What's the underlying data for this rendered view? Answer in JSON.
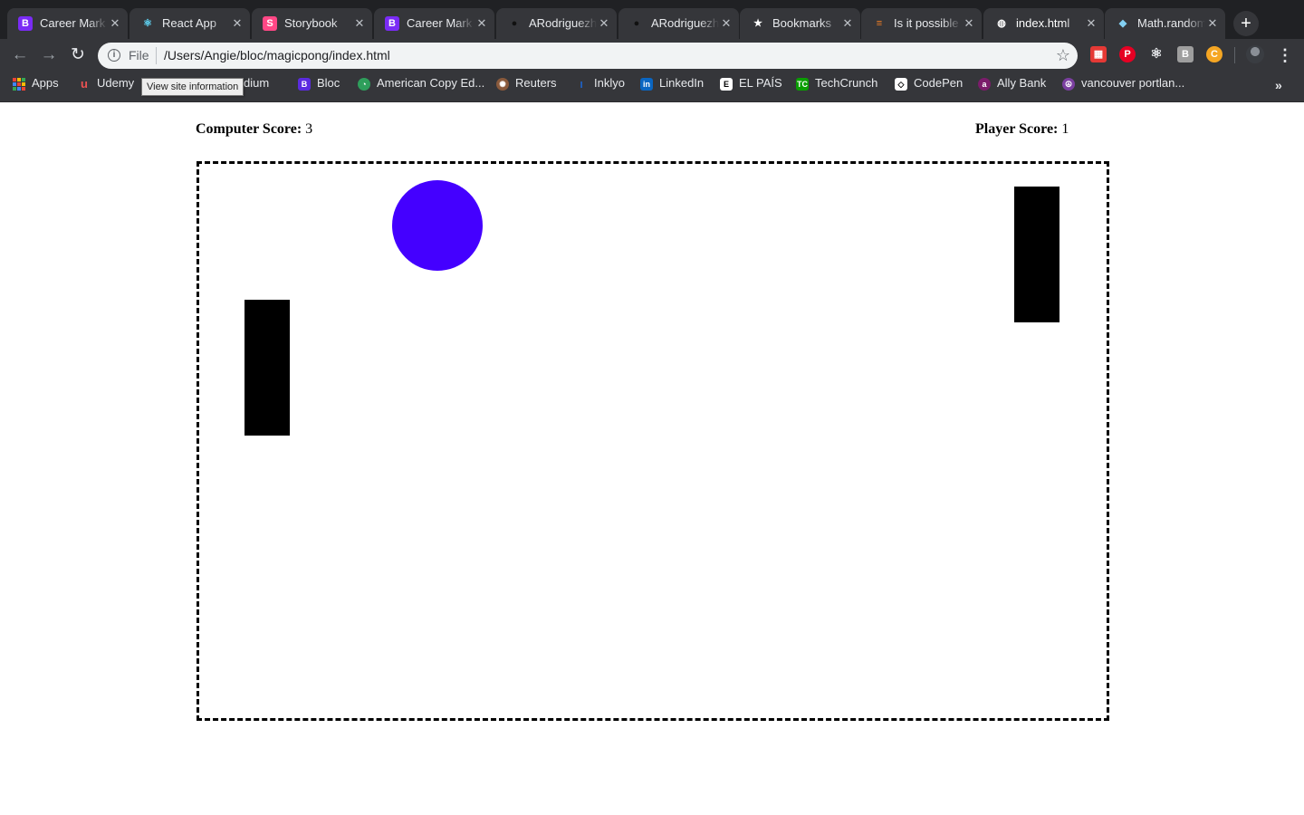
{
  "browser": {
    "tabs": [
      {
        "title": "Career Mark",
        "favicon": "bootstrap-icon",
        "favicon_char": "B",
        "favicon_color": "#7a2bf5"
      },
      {
        "title": "React App",
        "favicon": "react-icon",
        "favicon_char": "⚛",
        "favicon_color": "#61dafb"
      },
      {
        "title": "Storybook",
        "favicon": "storybook-icon",
        "favicon_char": "S",
        "favicon_color": "#ff4785"
      },
      {
        "title": "Career Mark",
        "favicon": "bootstrap-icon",
        "favicon_char": "B",
        "favicon_color": "#7a2bf5"
      },
      {
        "title": "ARodriguezh",
        "favicon": "github-icon",
        "favicon_char": "●",
        "favicon_color": "#111111"
      },
      {
        "title": "ARodriguezh",
        "favicon": "github-icon",
        "favicon_char": "●",
        "favicon_color": "#111111"
      },
      {
        "title": "Bookmarks",
        "favicon": "star-icon",
        "favicon_char": "★",
        "favicon_color": "#ffffff"
      },
      {
        "title": "Is it possible",
        "favicon": "stackoverflow-icon",
        "favicon_char": "≡",
        "favicon_color": "#f48024"
      },
      {
        "title": "index.html",
        "favicon": "globe-icon",
        "favicon_char": "◍",
        "favicon_color": "#ffffff",
        "active": true
      },
      {
        "title": "Math.random",
        "favicon": "mdn-icon",
        "favicon_char": "◆",
        "favicon_color": "#83d0f2"
      }
    ],
    "close_glyph": "✕",
    "new_tab_glyph": "+",
    "omnibox": {
      "scheme_chip": "File",
      "url": "/Users/Angie/bloc/magicpong/index.html"
    },
    "extensions": [
      {
        "name": "clapperboard-extension-icon",
        "char": "▦",
        "color": "#e53935"
      },
      {
        "name": "pinterest-extension-icon",
        "char": "P",
        "color": "#e60023"
      },
      {
        "name": "react-devtools-extension-icon",
        "char": "⚛",
        "color": "#35363a"
      },
      {
        "name": "bloc-extension-icon",
        "char": "B",
        "color": "#9e9e9e"
      },
      {
        "name": "cplus-extension-icon",
        "char": "C",
        "color": "#f5a623"
      }
    ],
    "bookmarks": [
      {
        "label": "Apps",
        "icon": "apps-grid-icon",
        "char": "",
        "color": "#ea4335"
      },
      {
        "label": "Udemy",
        "icon": "udemy-icon",
        "char": "u",
        "color": "#ec5252"
      },
      {
        "label": "Medium",
        "icon": "medium-icon",
        "char": "M",
        "color": "#000000"
      },
      {
        "label": "Bloc",
        "icon": "bloc-icon",
        "char": "B",
        "color": "#5b2be0"
      },
      {
        "label": "American Copy Ed...",
        "icon": "aces-icon",
        "char": "◔",
        "color": "#2e9e5b"
      },
      {
        "label": "Reuters",
        "icon": "reuters-icon",
        "char": "✺",
        "color": "#8a5a3c"
      },
      {
        "label": "Inklyo",
        "icon": "inklyo-icon",
        "char": "ı",
        "color": "#1f5fbf"
      },
      {
        "label": "LinkedIn",
        "icon": "linkedin-icon",
        "char": "in",
        "color": "#0a66c2"
      },
      {
        "label": "EL PAÍS",
        "icon": "elpais-icon",
        "char": "E",
        "color": "#ffffff"
      },
      {
        "label": "TechCrunch",
        "icon": "techcrunch-icon",
        "char": "TC",
        "color": "#0a9e01"
      },
      {
        "label": "CodePen",
        "icon": "codepen-icon",
        "char": "◇",
        "color": "#ffffff"
      },
      {
        "label": "Ally Bank",
        "icon": "allybank-icon",
        "char": "a",
        "color": "#7b1c6b"
      },
      {
        "label": "vancouver portlan...",
        "icon": "peace-icon",
        "char": "☮",
        "color": "#7b3fa0"
      }
    ],
    "tooltip": "View site information"
  },
  "game": {
    "computer_label": "Computer Score:",
    "computer_score": "3",
    "player_label": "Player Score:",
    "player_score": "1",
    "ball_color": "#4400ff",
    "paddle_color": "#000000"
  }
}
